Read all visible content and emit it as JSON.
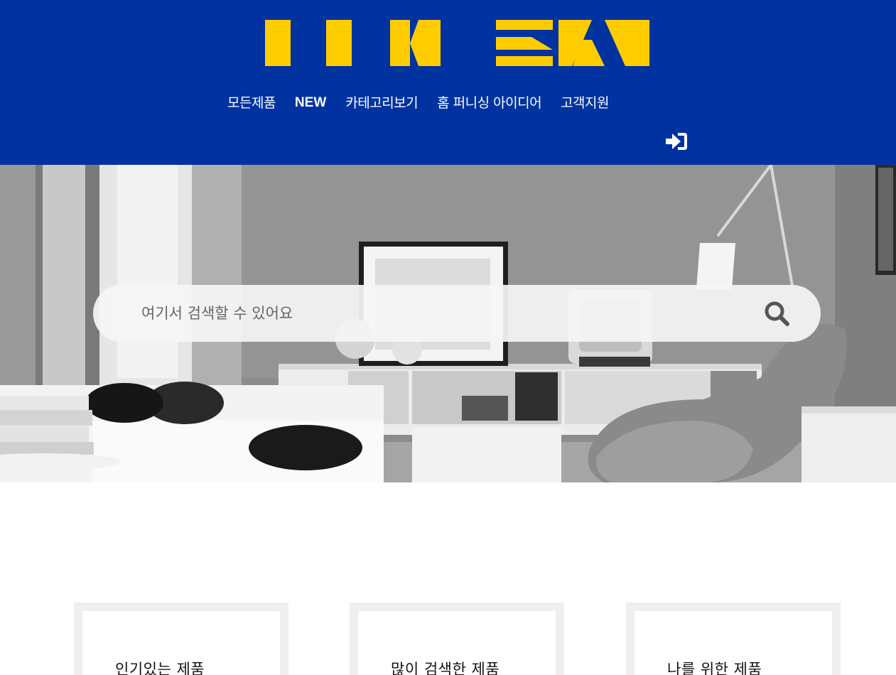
{
  "brand": {
    "name": "IKEA",
    "logo_color": "#ffcc00",
    "header_color": "#0033a0"
  },
  "nav": {
    "items": [
      {
        "label": "모든제품"
      },
      {
        "label": "NEW"
      },
      {
        "label": "카테고리보기"
      },
      {
        "label": "홈 퍼니싱 아이디어"
      },
      {
        "label": "고객지원"
      }
    ]
  },
  "header": {
    "login_icon": "sign-in-icon"
  },
  "search": {
    "placeholder": "여기서 검색할 수 있어요",
    "value": "",
    "icon": "search-icon"
  },
  "cards": [
    {
      "title": "인기있는 제품"
    },
    {
      "title": "많이 검색한 제품"
    },
    {
      "title": "나를 위한 제품"
    }
  ]
}
